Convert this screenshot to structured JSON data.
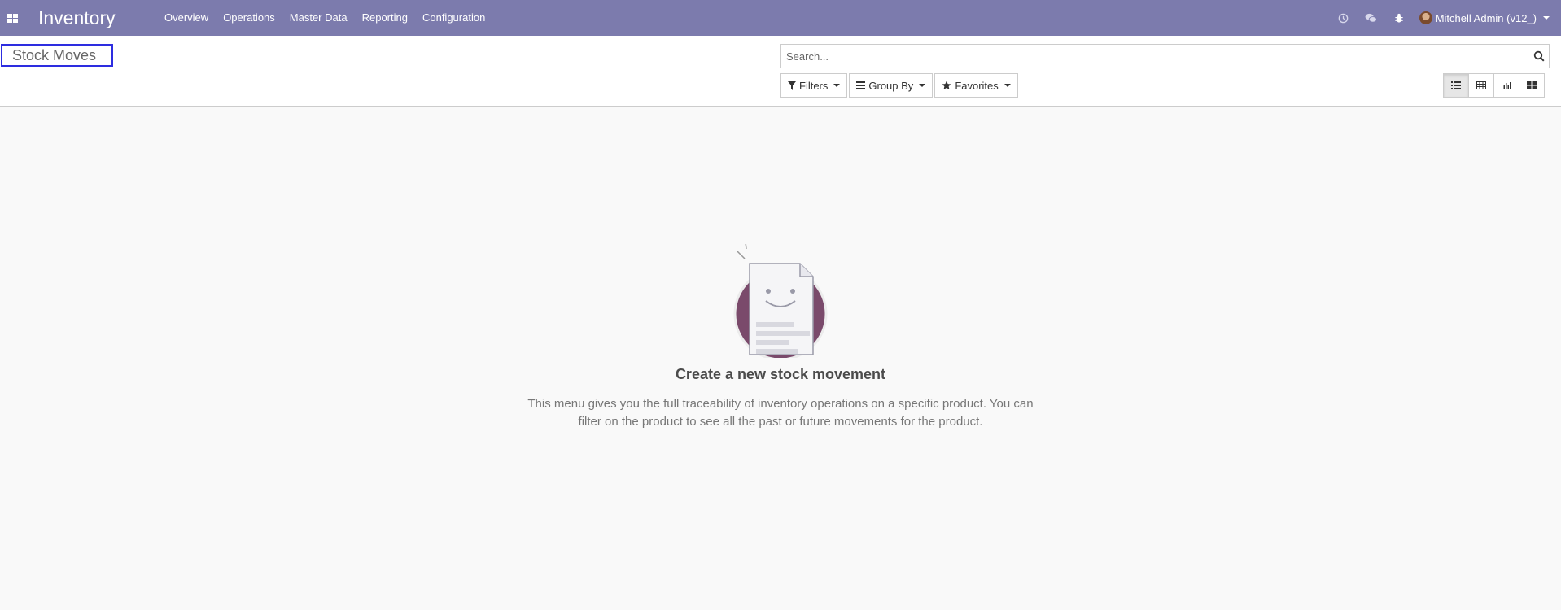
{
  "navbar": {
    "app_title": "Inventory",
    "menu": [
      "Overview",
      "Operations",
      "Master Data",
      "Reporting",
      "Configuration"
    ],
    "systray_icons": [
      "clock-icon",
      "chat-icon",
      "bug-icon"
    ],
    "user": "Mitchell Admin (v12_)"
  },
  "control_panel": {
    "breadcrumb": "Stock Moves",
    "search_placeholder": "Search...",
    "filters_label": "Filters",
    "groupby_label": "Group By",
    "favorites_label": "Favorites",
    "views": [
      "list-view-icon",
      "pivot-view-icon",
      "graph-view-icon",
      "kanban-view-icon"
    ],
    "active_view": "list-view-icon"
  },
  "helper": {
    "title": "Create a new stock movement",
    "text": "This menu gives you the full traceability of inventory operations on a specific product. You can filter on the product to see all the past or future movements for the product."
  },
  "colors": {
    "navbar": "#7c7bad",
    "breadcrumb_highlight": "#2d2de0",
    "illustration_circle": "#7a4a6b"
  }
}
